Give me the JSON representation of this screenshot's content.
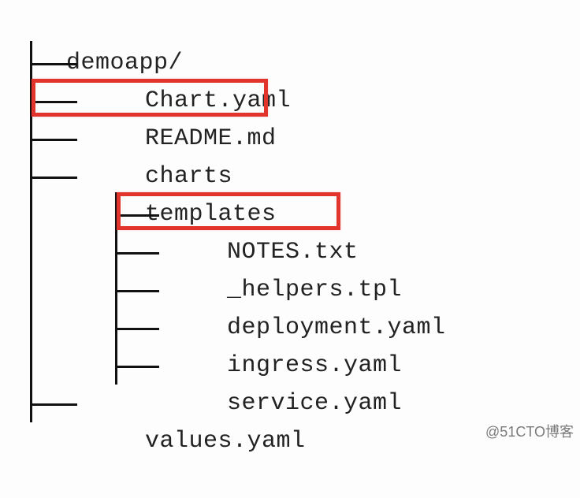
{
  "tree": {
    "root": "demoapp/",
    "children": [
      {
        "name": "Chart.yaml"
      },
      {
        "name": "README.md",
        "highlight": true
      },
      {
        "name": "charts"
      },
      {
        "name": "templates",
        "children": [
          {
            "name": "NOTES.txt",
            "highlight": true
          },
          {
            "name": "_helpers.tpl"
          },
          {
            "name": "deployment.yaml"
          },
          {
            "name": "ingress.yaml"
          },
          {
            "name": "service.yaml"
          }
        ]
      },
      {
        "name": "values.yaml"
      }
    ]
  },
  "watermark": "@51CTO博客"
}
